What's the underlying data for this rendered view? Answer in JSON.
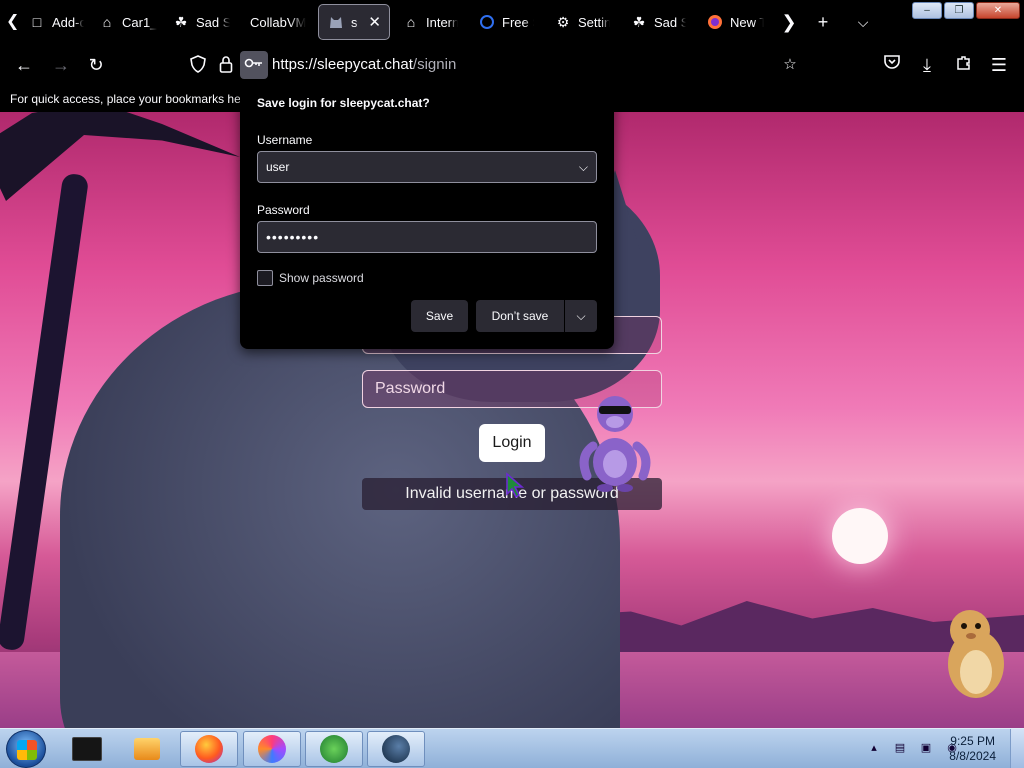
{
  "tabs": [
    {
      "label": "Add-o",
      "icon": "puzzle-icon"
    },
    {
      "label": "Car1_",
      "icon": "archive-icon"
    },
    {
      "label": "Sad S",
      "icon": "cat-face-icon"
    },
    {
      "label": "CollabVM",
      "icon": ""
    },
    {
      "label": "slee",
      "icon": "cat-avatar-icon",
      "active": true
    },
    {
      "label": "Intern",
      "icon": "archive-icon"
    },
    {
      "label": "Free S",
      "icon": "globe-icon"
    },
    {
      "label": "Settin",
      "icon": "gear-icon"
    },
    {
      "label": "Sad S",
      "icon": "cat-face-icon"
    },
    {
      "label": "New T",
      "icon": "firefox-icon"
    }
  ],
  "nav": {
    "url_host": "https://sleepycat.chat",
    "url_path": "/signin"
  },
  "bookmarks": {
    "hint": "For quick access, place your bookmarks her"
  },
  "save_login": {
    "title": "Save login for sleepycat.chat?",
    "username_label": "Username",
    "username_value": "user",
    "password_label": "Password",
    "password_value": "•••••••••",
    "show_password_label": "Show password",
    "save_label": "Save",
    "dont_save_label": "Don’t save"
  },
  "page": {
    "password_placeholder": "Password",
    "login_label": "Login",
    "error_message": "Invalid username or password"
  },
  "taskbar": {
    "time": "9:25 PM",
    "date": "8/8/2024"
  },
  "colors": {
    "accent_bg": "#000000",
    "field_bg": "#2b2a33",
    "page_pink": "#e04c95"
  }
}
